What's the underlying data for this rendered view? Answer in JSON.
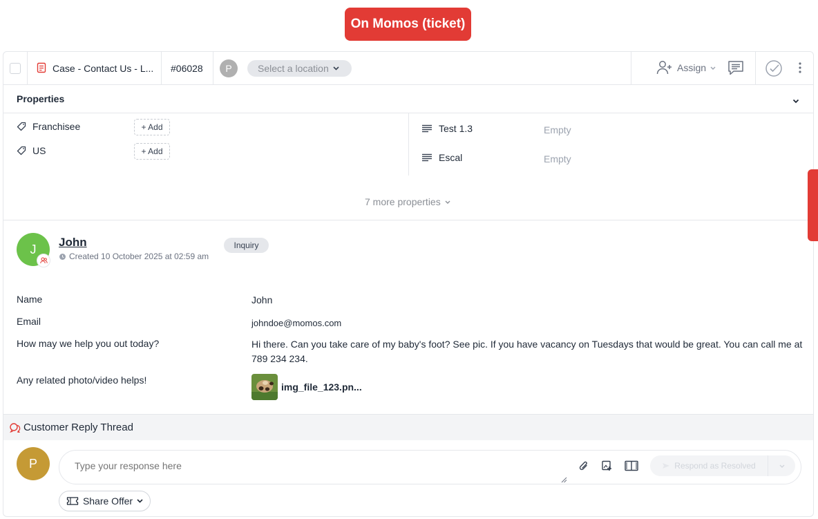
{
  "banner": {
    "label": "On Momos (ticket)"
  },
  "topbar": {
    "case_title": "Case - Contact Us - L...",
    "ticket_id": "#06028",
    "assignee_initial": "P",
    "location_placeholder": "Select a location",
    "assign_label": "Assign"
  },
  "properties": {
    "title": "Properties",
    "tags": [
      {
        "label": "Franchisee",
        "add_label": "+ Add"
      },
      {
        "label": "US",
        "add_label": "+ Add"
      }
    ],
    "fields": [
      {
        "label": "Test 1.3",
        "value": "Empty"
      },
      {
        "label": "Escal",
        "value": "Empty"
      }
    ],
    "more_label": "7 more properties"
  },
  "submission": {
    "customer_initial": "J",
    "customer_name": "John",
    "created": "Created 10 October 2025 at 02:59 am",
    "category": "Inquiry",
    "fields": [
      {
        "label": "Name",
        "value": "John"
      },
      {
        "label": "Email",
        "value": "johndoe@momos.com"
      },
      {
        "label": "How may we help you out today?",
        "value": "Hi there. Can you take care of my baby's foot? See pic. If you have vacancy on Tuesdays that would be great. You can call me at 789 234 234."
      },
      {
        "label": "Any related photo/video helps!",
        "value": "img_file_123.pn..."
      }
    ]
  },
  "thread": {
    "title": "Customer Reply Thread",
    "agent_initial": "P",
    "reply_placeholder": "Type your response here",
    "resolve_label": "Respond as Resolved",
    "share_offer_label": "Share Offer"
  },
  "colors": {
    "brand_red": "#e23b35",
    "customer_avatar": "#6cc24a",
    "agent_avatar": "#c59a35"
  }
}
